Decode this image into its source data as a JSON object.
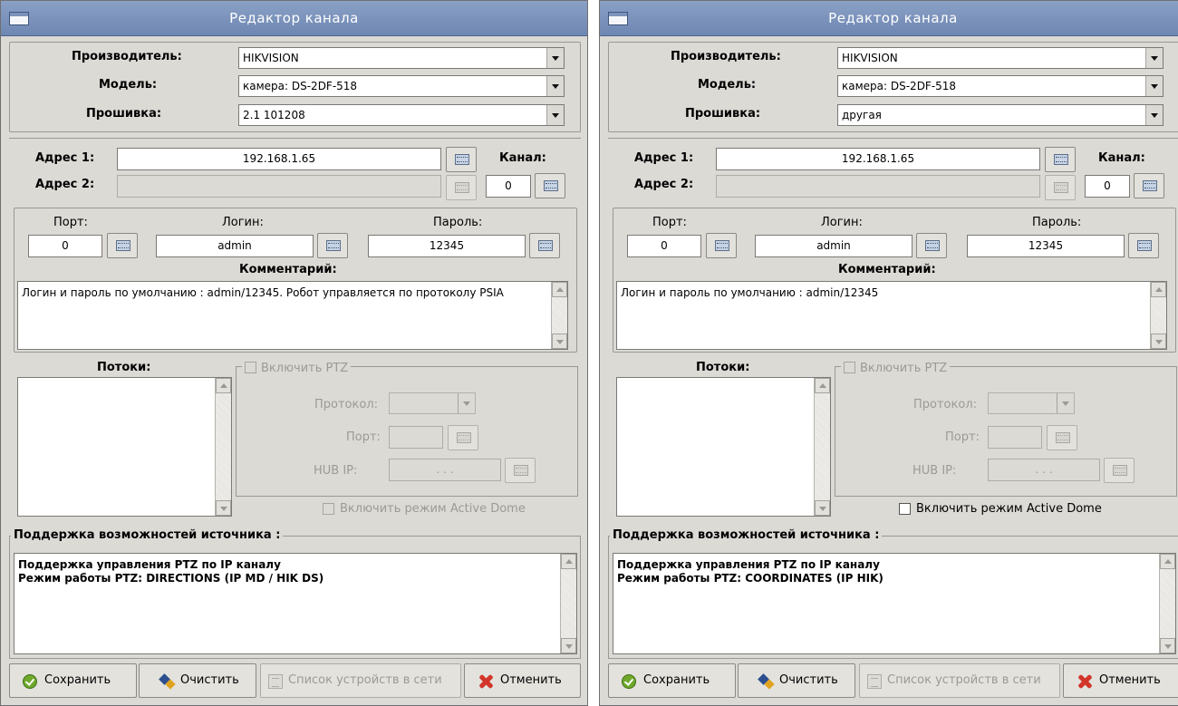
{
  "windows": [
    {
      "title": "Редактор канала",
      "manufacturer_label": "Производитель:",
      "manufacturer_value": "HIKVISION",
      "model_label": "Модель:",
      "model_value": "камера: DS-2DF-518",
      "firmware_label": "Прошивка:",
      "firmware_value": "2.1 101208",
      "address1_label": "Адрес 1:",
      "address1_value": "192.168.1.65",
      "address2_label": "Адрес 2:",
      "address2_value": "",
      "channel_label": "Канал:",
      "channel_value": "0",
      "port_label": "Порт:",
      "port_value": "0",
      "login_label": "Логин:",
      "login_value": "admin",
      "password_label": "Пароль:",
      "password_value": "12345",
      "comment_label": "Комментарий:",
      "comment_value": "Логин и пароль по умолчанию : admin/12345. Робот управляется по протоколу PSIA",
      "streams_label": "Потоки:",
      "ptz_enable_label": "Включить PTZ",
      "ptz_enable_checked": false,
      "ptz_protocol_label": "Протокол:",
      "ptz_protocol_value": "",
      "ptz_port_label": "Порт:",
      "ptz_port_value": "",
      "ptz_hub_ip_label": "HUB IP:",
      "ptz_hub_ip_value": ". . .",
      "active_dome_label": "Включить режим Active Dome",
      "active_dome_enabled": false,
      "support_label": "Поддержка возможностей источника :",
      "support_line1": "Поддержка управления PTZ по IP каналу",
      "support_line2": "Режим работы PTZ: DIRECTIONS (IP MD / HIK DS)",
      "btn_save": "Сохранить",
      "btn_clear": "Очистить",
      "btn_devices": "Список устройств в сети",
      "btn_cancel": "Отменить"
    },
    {
      "title": "Редактор канала",
      "manufacturer_label": "Производитель:",
      "manufacturer_value": "HIKVISION",
      "model_label": "Модель:",
      "model_value": "камера: DS-2DF-518",
      "firmware_label": "Прошивка:",
      "firmware_value": "другая",
      "address1_label": "Адрес 1:",
      "address1_value": "192.168.1.65",
      "address2_label": "Адрес 2:",
      "address2_value": "",
      "channel_label": "Канал:",
      "channel_value": "0",
      "port_label": "Порт:",
      "port_value": "0",
      "login_label": "Логин:",
      "login_value": "admin",
      "password_label": "Пароль:",
      "password_value": "12345",
      "comment_label": "Комментарий:",
      "comment_value": "Логин и пароль по умолчанию : admin/12345",
      "streams_label": "Потоки:",
      "ptz_enable_label": "Включить PTZ",
      "ptz_enable_checked": false,
      "ptz_protocol_label": "Протокол:",
      "ptz_protocol_value": "",
      "ptz_port_label": "Порт:",
      "ptz_port_value": "",
      "ptz_hub_ip_label": "HUB IP:",
      "ptz_hub_ip_value": ". . .",
      "active_dome_label": "Включить режим Active Dome",
      "active_dome_enabled": true,
      "support_label": "Поддержка возможностей источника :",
      "support_line1": "Поддержка управления PTZ по IP каналу",
      "support_line2": "Режим работы PTZ: COORDINATES (IP HIK)",
      "btn_save": "Сохранить",
      "btn_clear": "Очистить",
      "btn_devices": "Список устройств в сети",
      "btn_cancel": "Отменить"
    }
  ],
  "colors": {
    "titlebar": "#7b92bb",
    "window_bg": "#dcdad5",
    "disabled_text": "#9c9a95",
    "ok_icon": "#6fa82a",
    "cancel_icon": "#d2362a"
  }
}
